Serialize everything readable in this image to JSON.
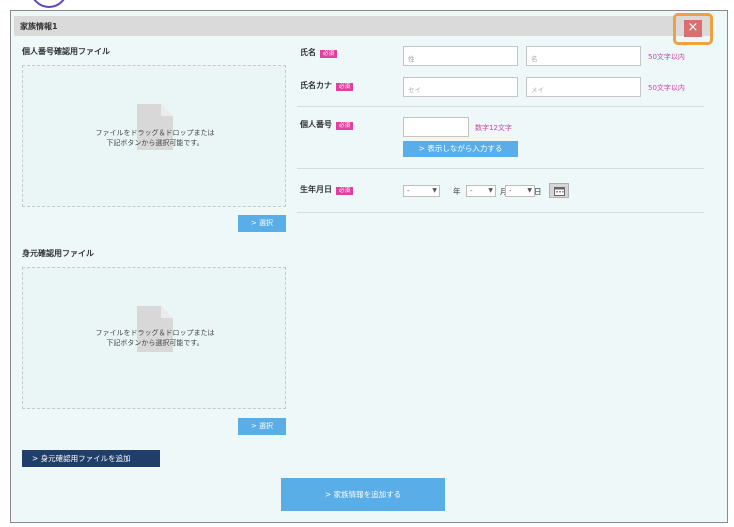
{
  "header": {
    "title": "家族情報1",
    "close_label": "×"
  },
  "left": {
    "mynumber_title": "個人番号確認用ファイル",
    "id_title": "身元確認用ファイル",
    "dropzone_text_line1": "ファイルをドラッグ＆ドロップまたは",
    "dropzone_text_line2": "下記ボタンから選択可能です。",
    "select_label": "> 選択",
    "add_id_file_label": "> 身元確認用ファイルを追加"
  },
  "form": {
    "required_badge": "必須",
    "name": {
      "label": "氏名",
      "last_placeholder": "姓",
      "first_placeholder": "名",
      "hint": "50文字以内"
    },
    "kana": {
      "label": "氏名カナ",
      "last_placeholder": "セイ",
      "first_placeholder": "メイ",
      "hint": "50文字以内"
    },
    "mynumber": {
      "label": "個人番号",
      "value": "",
      "hint": "数字12文字",
      "reveal_label": "> 表示しながら入力する"
    },
    "birth": {
      "label": "生年月日",
      "year_value": "-",
      "year_unit": "年",
      "month_value": "-",
      "month_unit": "月",
      "day_value": "-",
      "day_unit": "日"
    }
  },
  "footer": {
    "add_family_label": "> 家族情報を追加する"
  },
  "colors": {
    "accent": "#5aaee8",
    "dark_button": "#1f3f6a",
    "required": "#e040a0",
    "close": "#d87070",
    "highlight": "#f0a040"
  },
  "icons": {
    "close": "close-icon",
    "file": "file-icon",
    "calendar": "calendar-icon"
  }
}
